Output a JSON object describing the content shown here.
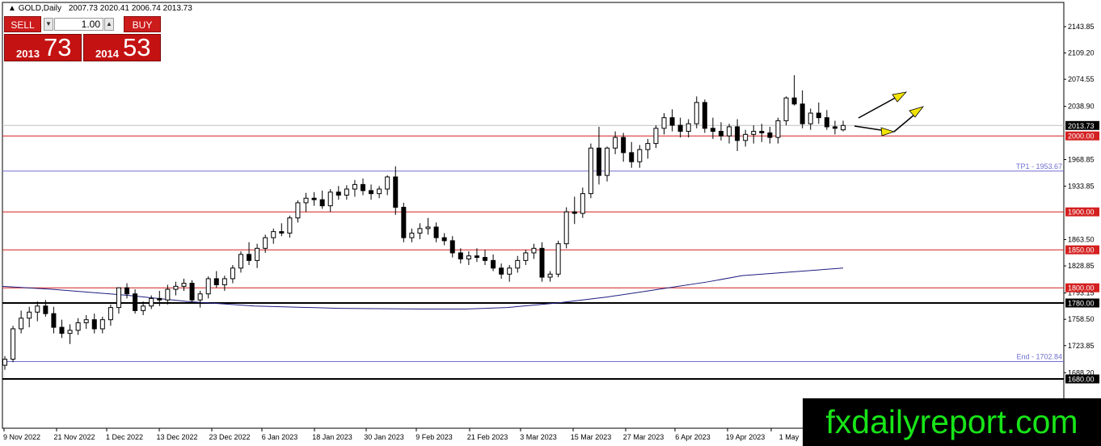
{
  "header": {
    "symbol_label": "GOLD,Daily",
    "open": "2007.73",
    "high": "2020.41",
    "low": "2006.74",
    "close": "2013.73"
  },
  "trade_panel": {
    "sell_label": "SELL",
    "buy_label": "BUY",
    "lot": "1.00",
    "bid_small": "2013",
    "bid_large": "73",
    "ask_small": "2014",
    "ask_large": "53"
  },
  "watermark": "fxdailyreport.com",
  "chart_data": {
    "type": "candlestick",
    "title": "GOLD,Daily",
    "ylim": [
      1668.0,
      2163.0
    ],
    "price_ticks": [
      "2143.85",
      "2109.20",
      "2074.55",
      "2038.90",
      "1968.85",
      "1933.85",
      "1863.50",
      "1828.85",
      "1793.15",
      "1758.50",
      "1723.85",
      "1688.20"
    ],
    "date_labels": [
      "9 Nov 2022",
      "21 Nov 2022",
      "1 Dec 2022",
      "13 Dec 2022",
      "23 Dec 2022",
      "6 Jan 2023",
      "18 Jan 2023",
      "30 Jan 2023",
      "9 Feb 2023",
      "21 Feb 2023",
      "3 Mar 2023",
      "15 Mar 2023",
      "27 Mar 2023",
      "6 Apr 2023",
      "19 Apr 2023",
      "1 May"
    ],
    "levels": [
      {
        "value": 2000.0,
        "label": "2000.00",
        "color": "#d42020",
        "style": "solid"
      },
      {
        "value": 1953.67,
        "label": "TP1 - 1953.67",
        "color": "#6f6fd0",
        "style": "solid"
      },
      {
        "value": 1900.0,
        "label": "1900.00",
        "color": "#d42020",
        "style": "solid"
      },
      {
        "value": 1850.0,
        "label": "1850.00",
        "color": "#d42020",
        "style": "solid"
      },
      {
        "value": 1800.0,
        "label": "1800.00",
        "color": "#d42020",
        "style": "solid"
      },
      {
        "value": 1780.0,
        "label": "1780.00",
        "color": "#000000",
        "style": "thick"
      },
      {
        "value": 1702.84,
        "label": "End - 1702.84",
        "color": "#6f6fd0",
        "style": "solid"
      },
      {
        "value": 1680.0,
        "label": "1680.00",
        "color": "#000000",
        "style": "thick"
      }
    ],
    "current_price": {
      "value": 2013.73,
      "label": "2013.73"
    },
    "candles_ohlc": [
      [
        1698,
        1710,
        1692,
        1706
      ],
      [
        1706,
        1750,
        1702,
        1746
      ],
      [
        1746,
        1770,
        1740,
        1760
      ],
      [
        1760,
        1775,
        1748,
        1768
      ],
      [
        1768,
        1782,
        1756,
        1776
      ],
      [
        1776,
        1784,
        1762,
        1766
      ],
      [
        1766,
        1775,
        1740,
        1748
      ],
      [
        1748,
        1758,
        1734,
        1740
      ],
      [
        1740,
        1752,
        1726,
        1744
      ],
      [
        1744,
        1760,
        1738,
        1754
      ],
      [
        1754,
        1764,
        1746,
        1758
      ],
      [
        1758,
        1766,
        1740,
        1746
      ],
      [
        1746,
        1762,
        1740,
        1758
      ],
      [
        1758,
        1778,
        1750,
        1774
      ],
      [
        1774,
        1800,
        1766,
        1800
      ],
      [
        1800,
        1806,
        1786,
        1792
      ],
      [
        1792,
        1798,
        1766,
        1770
      ],
      [
        1770,
        1782,
        1764,
        1776
      ],
      [
        1776,
        1790,
        1772,
        1786
      ],
      [
        1786,
        1796,
        1776,
        1784
      ],
      [
        1784,
        1804,
        1778,
        1798
      ],
      [
        1798,
        1808,
        1790,
        1802
      ],
      [
        1802,
        1812,
        1796,
        1806
      ],
      [
        1806,
        1810,
        1780,
        1784
      ],
      [
        1784,
        1796,
        1774,
        1792
      ],
      [
        1792,
        1815,
        1786,
        1812
      ],
      [
        1812,
        1822,
        1800,
        1804
      ],
      [
        1804,
        1816,
        1796,
        1812
      ],
      [
        1812,
        1830,
        1806,
        1826
      ],
      [
        1826,
        1848,
        1820,
        1844
      ],
      [
        1844,
        1860,
        1830,
        1836
      ],
      [
        1836,
        1858,
        1826,
        1852
      ],
      [
        1852,
        1870,
        1846,
        1866
      ],
      [
        1866,
        1878,
        1858,
        1874
      ],
      [
        1874,
        1885,
        1868,
        1872
      ],
      [
        1872,
        1895,
        1866,
        1892
      ],
      [
        1892,
        1915,
        1886,
        1912
      ],
      [
        1912,
        1925,
        1900,
        1918
      ],
      [
        1918,
        1926,
        1908,
        1916
      ],
      [
        1916,
        1928,
        1904,
        1908
      ],
      [
        1908,
        1930,
        1900,
        1926
      ],
      [
        1926,
        1934,
        1916,
        1922
      ],
      [
        1922,
        1935,
        1916,
        1930
      ],
      [
        1930,
        1942,
        1920,
        1936
      ],
      [
        1936,
        1944,
        1922,
        1928
      ],
      [
        1928,
        1936,
        1916,
        1924
      ],
      [
        1924,
        1934,
        1918,
        1930
      ],
      [
        1930,
        1948,
        1922,
        1946
      ],
      [
        1946,
        1960,
        1896,
        1906
      ],
      [
        1906,
        1912,
        1860,
        1866
      ],
      [
        1866,
        1878,
        1860,
        1872
      ],
      [
        1872,
        1885,
        1864,
        1878
      ],
      [
        1878,
        1892,
        1870,
        1880
      ],
      [
        1880,
        1886,
        1860,
        1866
      ],
      [
        1866,
        1872,
        1856,
        1862
      ],
      [
        1862,
        1868,
        1840,
        1846
      ],
      [
        1846,
        1852,
        1832,
        1838
      ],
      [
        1838,
        1848,
        1830,
        1842
      ],
      [
        1842,
        1852,
        1834,
        1840
      ],
      [
        1840,
        1850,
        1830,
        1836
      ],
      [
        1836,
        1844,
        1822,
        1826
      ],
      [
        1826,
        1832,
        1812,
        1818
      ],
      [
        1818,
        1830,
        1808,
        1826
      ],
      [
        1826,
        1842,
        1820,
        1836
      ],
      [
        1836,
        1850,
        1830,
        1846
      ],
      [
        1846,
        1858,
        1838,
        1852
      ],
      [
        1852,
        1860,
        1808,
        1814
      ],
      [
        1814,
        1822,
        1808,
        1818
      ],
      [
        1818,
        1862,
        1814,
        1858
      ],
      [
        1858,
        1906,
        1852,
        1900
      ],
      [
        1900,
        1920,
        1884,
        1898
      ],
      [
        1898,
        1932,
        1892,
        1924
      ],
      [
        1924,
        1990,
        1918,
        1984
      ],
      [
        1984,
        2012,
        1936,
        1948
      ],
      [
        1948,
        1986,
        1940,
        1984
      ],
      [
        1984,
        2006,
        1976,
        1998
      ],
      [
        1998,
        2004,
        1966,
        1978
      ],
      [
        1978,
        1992,
        1958,
        1966
      ],
      [
        1966,
        1988,
        1958,
        1982
      ],
      [
        1982,
        1996,
        1970,
        1990
      ],
      [
        1990,
        2014,
        1984,
        2010
      ],
      [
        2010,
        2030,
        2002,
        2024
      ],
      [
        2024,
        2035,
        2006,
        2014
      ],
      [
        2014,
        2024,
        1998,
        2006
      ],
      [
        2006,
        2022,
        1998,
        2016
      ],
      [
        2016,
        2052,
        2010,
        2044
      ],
      [
        2044,
        2048,
        2004,
        2010
      ],
      [
        2010,
        2024,
        1996,
        2006
      ],
      [
        2006,
        2018,
        1994,
        2000
      ],
      [
        2000,
        2016,
        1990,
        2012
      ],
      [
        2012,
        2022,
        1980,
        1994
      ],
      [
        1994,
        2008,
        1986,
        2002
      ],
      [
        2002,
        2014,
        1990,
        2006
      ],
      [
        2006,
        2016,
        1992,
        2004
      ],
      [
        2004,
        2012,
        1990,
        1998
      ],
      [
        1998,
        2024,
        1990,
        2020
      ],
      [
        2020,
        2052,
        2014,
        2050
      ],
      [
        2050,
        2080,
        2040,
        2042
      ],
      [
        2042,
        2060,
        2010,
        2016
      ],
      [
        2016,
        2036,
        2008,
        2030
      ],
      [
        2030,
        2044,
        2016,
        2024
      ],
      [
        2024,
        2034,
        2008,
        2012
      ],
      [
        2012,
        2020,
        2002,
        2010
      ],
      [
        2008,
        2020,
        2006,
        2013.73
      ]
    ],
    "moving_average": [
      [
        0,
        1802
      ],
      [
        0.06,
        1798
      ],
      [
        0.15,
        1790
      ],
      [
        0.22,
        1782
      ],
      [
        0.3,
        1776
      ],
      [
        0.4,
        1773
      ],
      [
        0.5,
        1772
      ],
      [
        0.55,
        1772
      ],
      [
        0.6,
        1774
      ],
      [
        0.66,
        1780
      ],
      [
        0.72,
        1788
      ],
      [
        0.78,
        1798
      ],
      [
        0.84,
        1808
      ],
      [
        0.88,
        1816
      ],
      [
        1.0,
        1826
      ]
    ]
  }
}
